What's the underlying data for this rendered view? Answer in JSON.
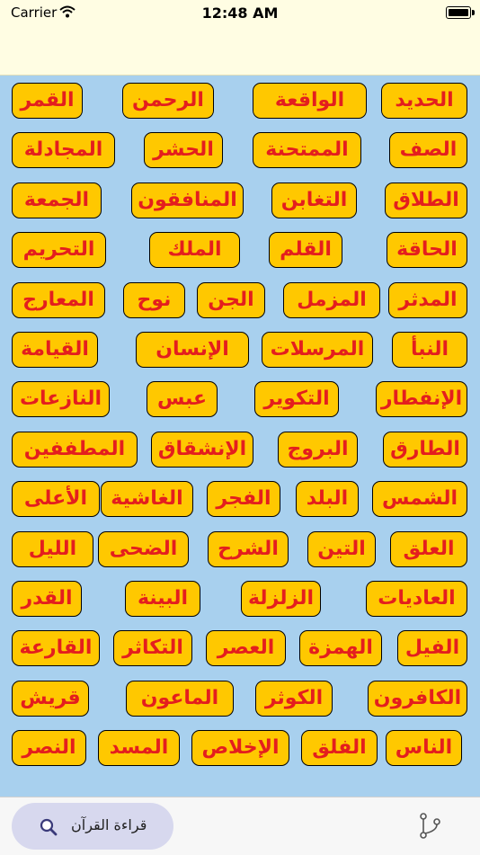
{
  "status_bar": {
    "carrier": "Carrier",
    "time": "12:48 AM"
  },
  "surahs": [
    [
      "القمر",
      "الرحمن",
      "الواقعة",
      "الحديد"
    ],
    [
      "المجادلة",
      "الحشر",
      "الممتحنة",
      "الصف"
    ],
    [
      "الجمعة",
      "المنافقون",
      "التغابن",
      "الطلاق"
    ],
    [
      "التحريم",
      "الملك",
      "القلم",
      "الحاقة"
    ],
    [
      "المعارج",
      "نوح",
      "الجن",
      "المزمل",
      "المدثر"
    ],
    [
      "القيامة",
      "الإنسان",
      "المرسلات",
      "النبأ"
    ],
    [
      "النازعات",
      "عبس",
      "التكوير",
      "الإنفطار"
    ],
    [
      "المطففين",
      "الإنشقاق",
      "البروج",
      "الطارق"
    ],
    [
      "الأعلى",
      "الغاشية",
      "الفجر",
      "البلد",
      "الشمس"
    ],
    [
      "الليل",
      "الضحى",
      "الشرح",
      "التين",
      "العلق"
    ],
    [
      "القدر",
      "البينة",
      "الزلزلة",
      "العاديات"
    ],
    [
      "القارعة",
      "التكاثر",
      "العصر",
      "الهمزة",
      "الفيل"
    ],
    [
      "قريش",
      "الماعون",
      "الكوثر",
      "الكافرون"
    ],
    [
      "النصر",
      "المسد",
      "الإخلاص",
      "الفلق",
      "الناس"
    ]
  ],
  "bottom_bar": {
    "read_label": "قراءة القرآن"
  },
  "icons": {
    "search": "search-icon",
    "branch": "branch-icon",
    "wifi": "wifi-icon",
    "battery": "battery-icon"
  },
  "colors": {
    "chip_bg": "#ffc800",
    "chip_text": "#e41e1e",
    "grid_bg": "#a8d0ee",
    "header_bg": "#fffde3"
  }
}
